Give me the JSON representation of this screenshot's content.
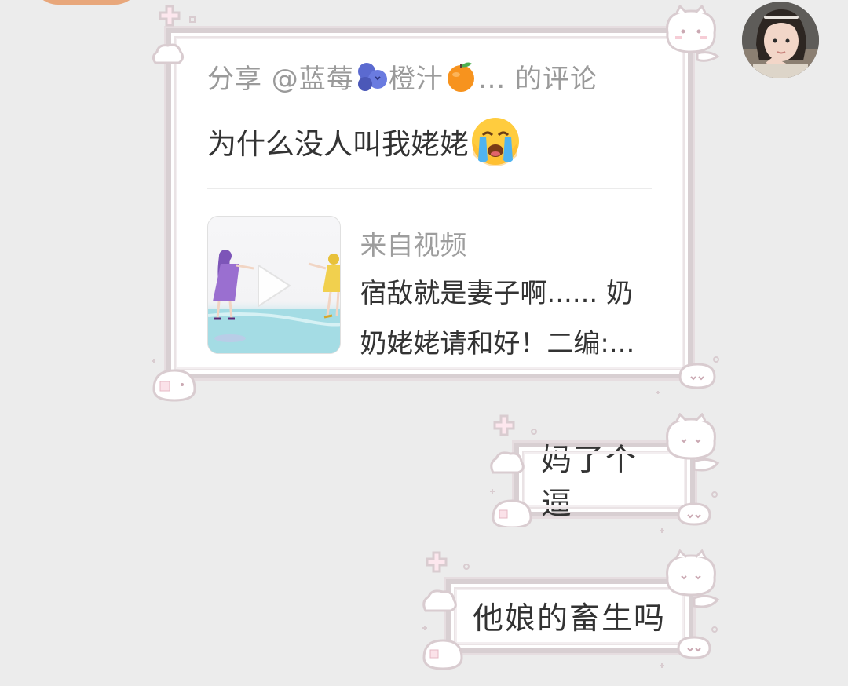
{
  "card": {
    "header_prefix": "分享 @蓝莓",
    "header_middle": "橙汁",
    "header_suffix": "... 的评论",
    "comment": "为什么没人叫我姥姥",
    "source_label": "来自视频",
    "video_title": "宿敌就是妻子啊...... 奶奶姥姥请和好！二编:..."
  },
  "messages": [
    {
      "text": "妈了个逼"
    },
    {
      "text": "他娘的畜生吗"
    }
  ],
  "icons": {
    "blueberry": "blueberry-emoji",
    "orange": "tangerine-emoji",
    "crying": "loudly-crying-face-emoji",
    "play": "play-icon"
  },
  "colors": {
    "background": "#ececec",
    "bubble_border": "#d8cfd2",
    "text": "#333333",
    "muted_text": "#9a9a9a"
  }
}
